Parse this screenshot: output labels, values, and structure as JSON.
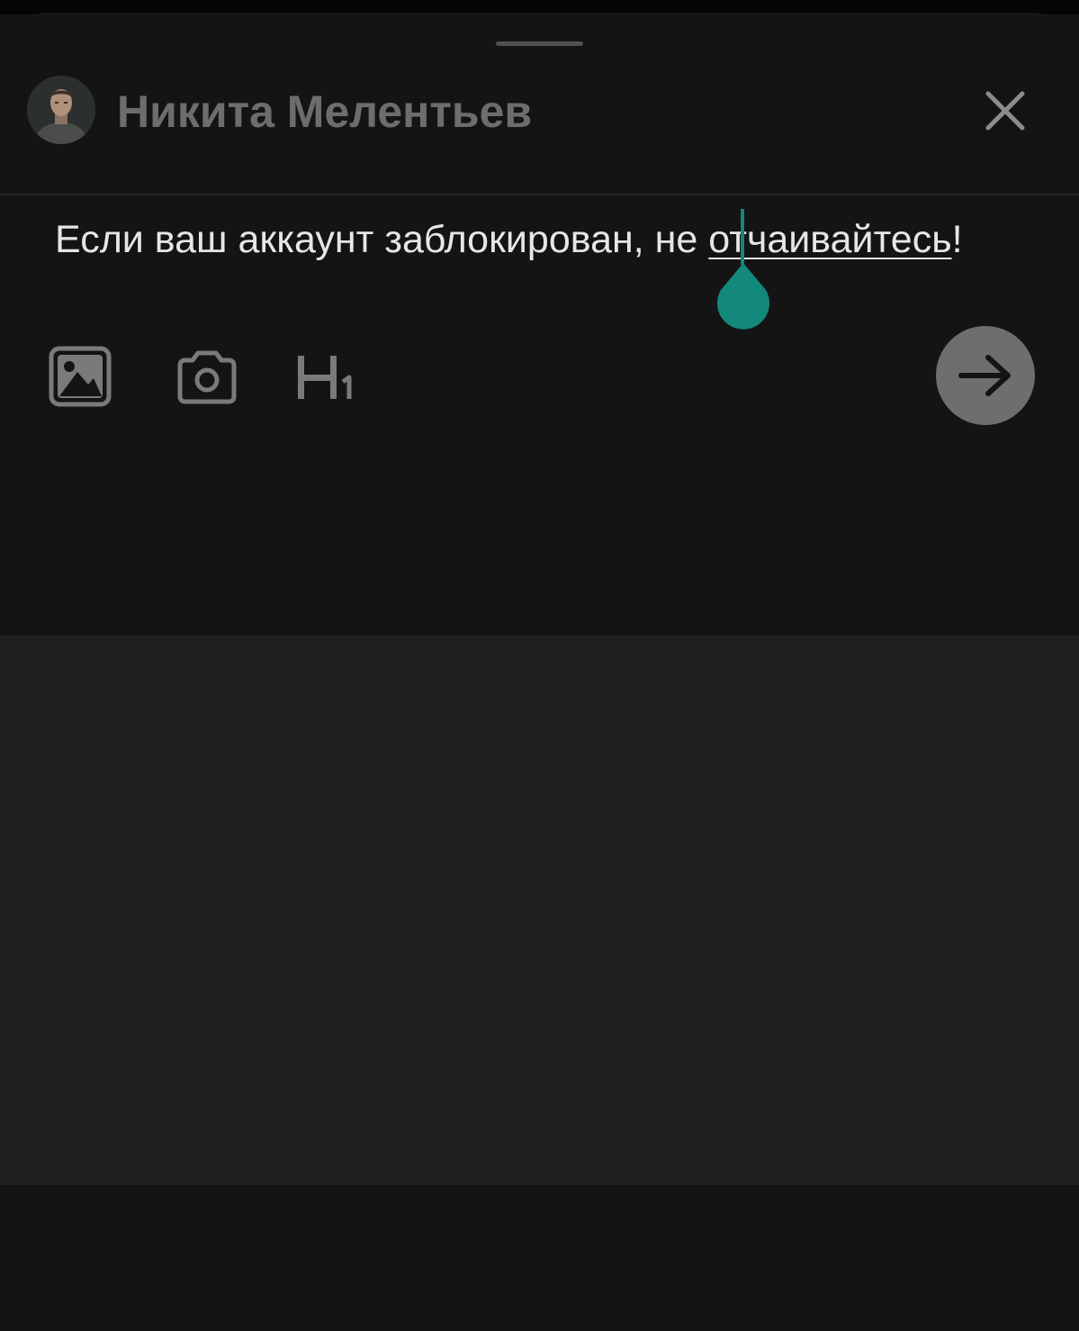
{
  "header": {
    "author_name": "Никита Мелентьев"
  },
  "editor": {
    "text_before": "Если ваш аккаунт заблокирован, не ",
    "text_misspelled": "отчаивайтесь",
    "text_after": "!"
  },
  "toolbar": {
    "icons": [
      "image-icon",
      "camera-icon",
      "heading-h1-icon"
    ]
  },
  "send": {
    "icon": "arrow-right-icon"
  },
  "colors": {
    "accent_caret": "#12897a",
    "send_button": "#6e6e6e",
    "background": "#141414"
  }
}
